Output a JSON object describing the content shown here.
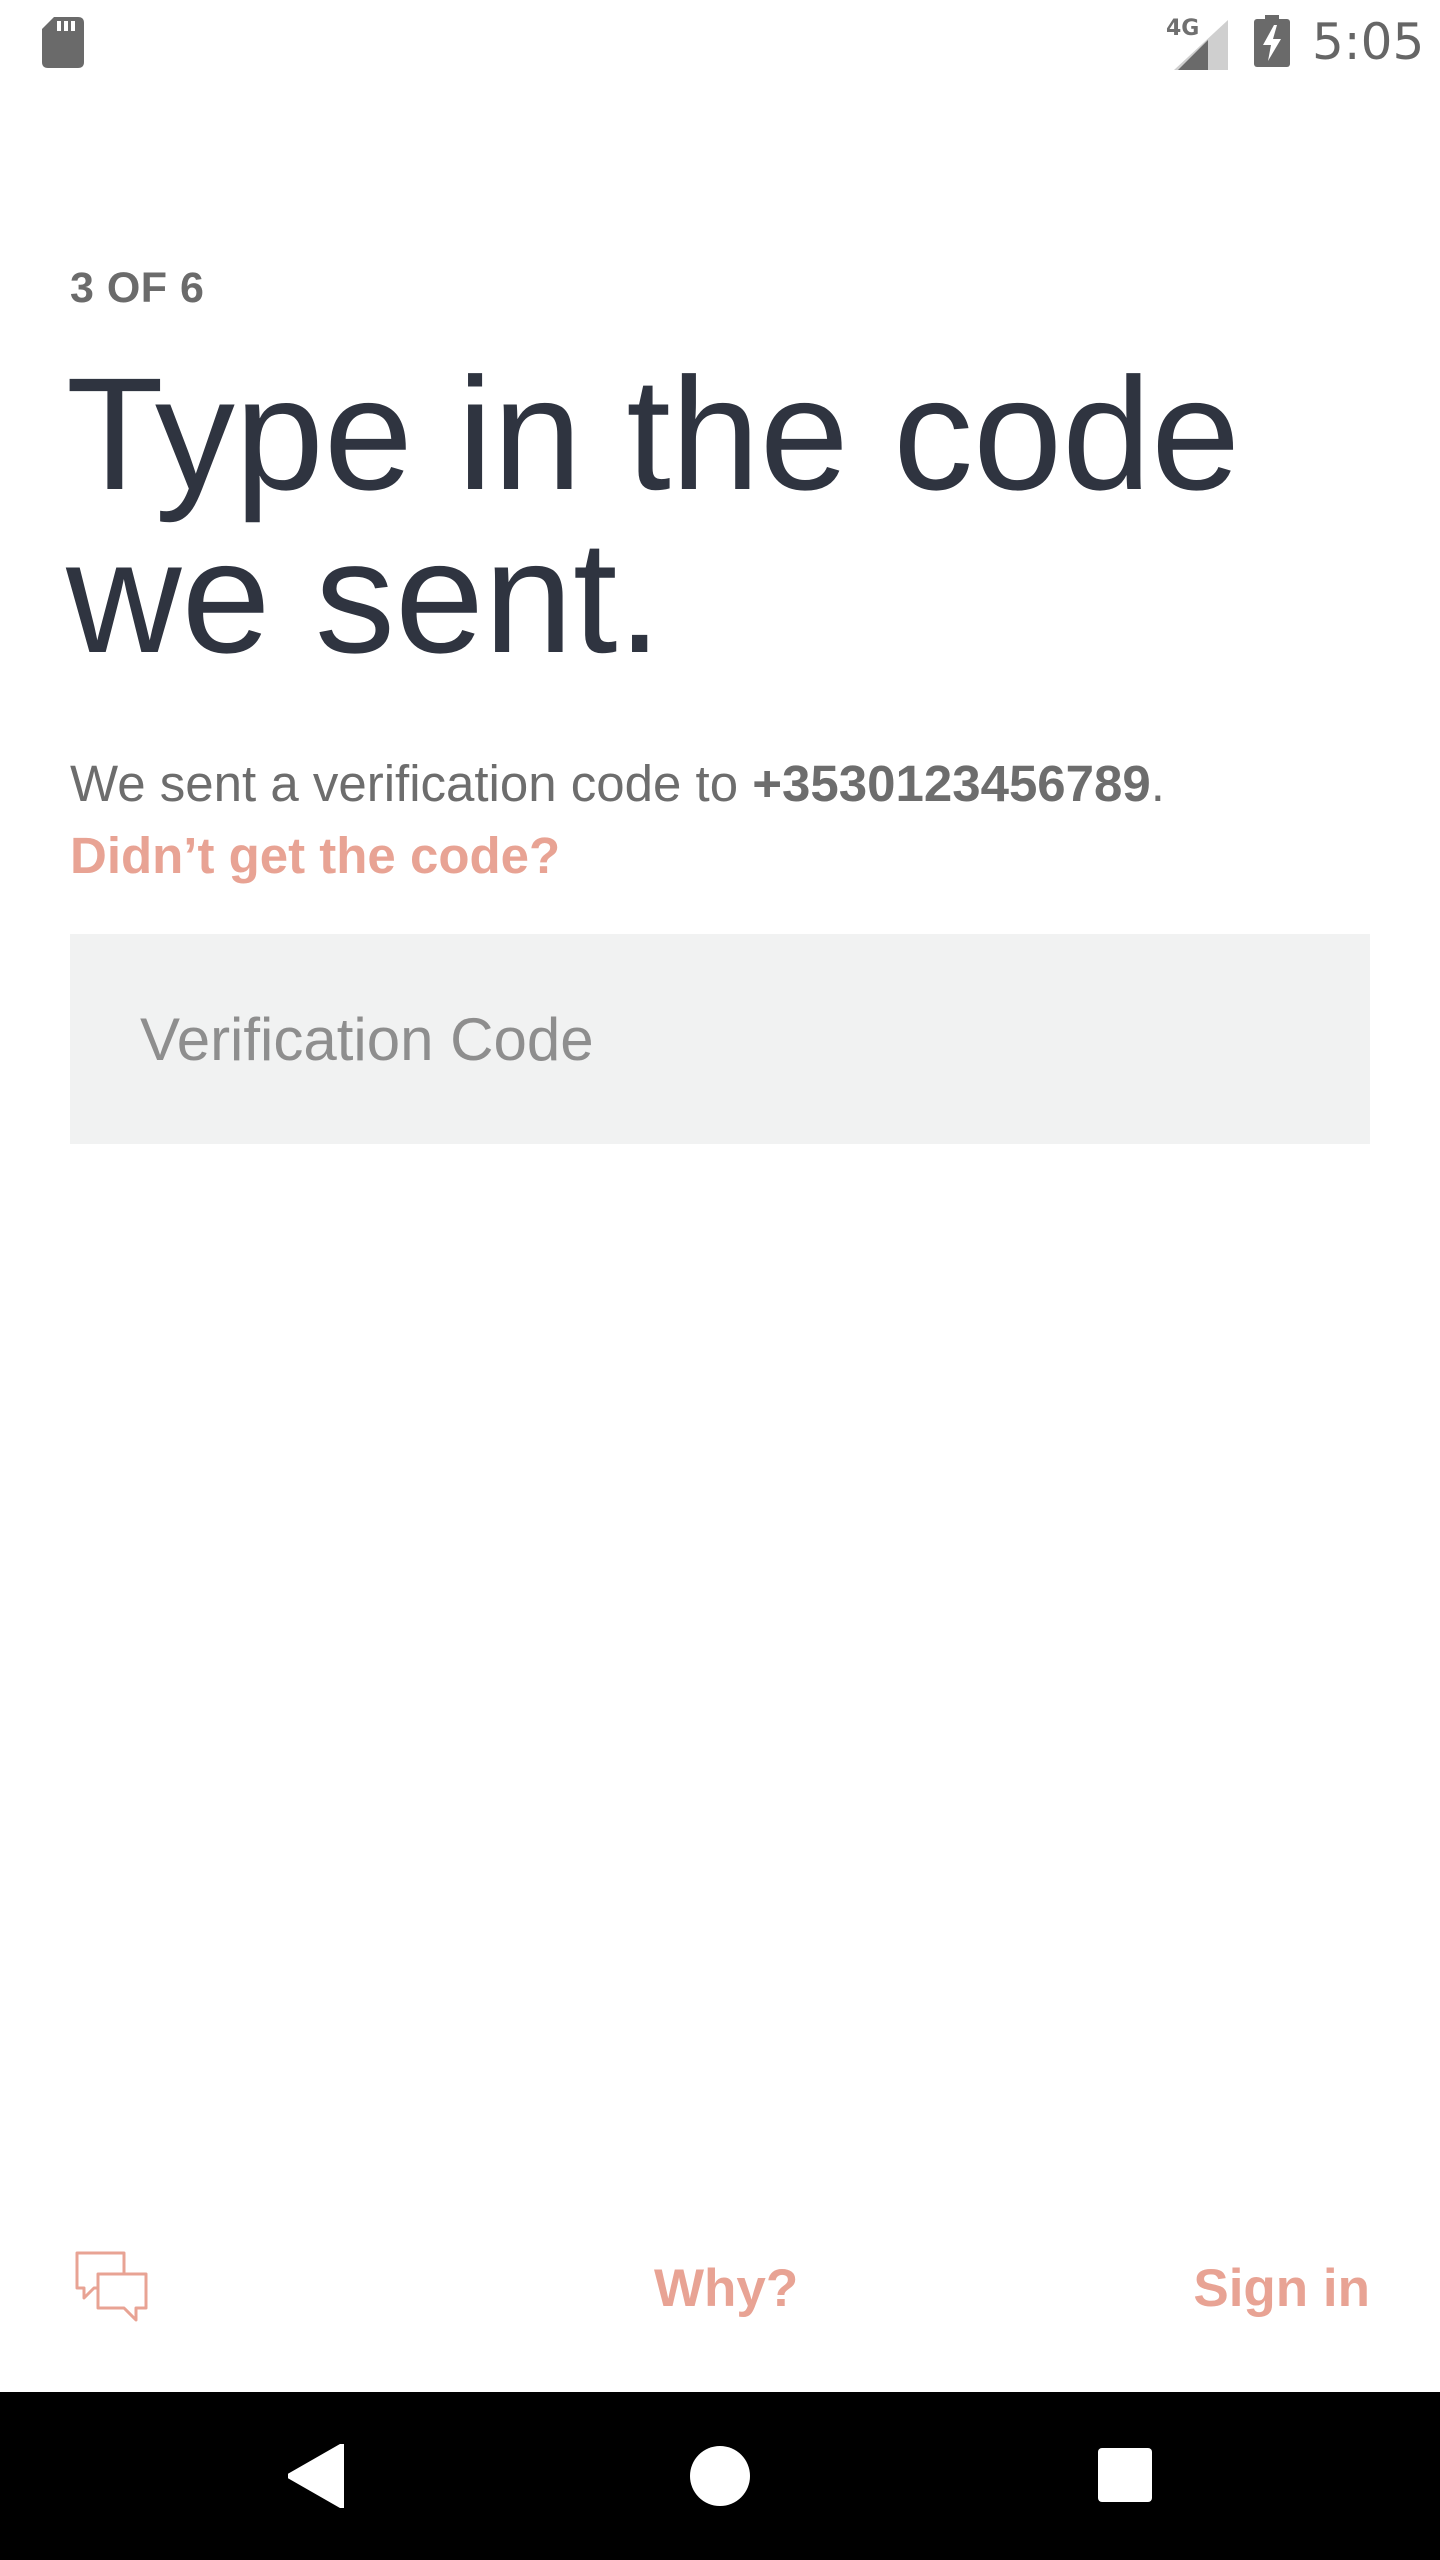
{
  "status_bar": {
    "network": "4G",
    "time": "5:05",
    "icons": [
      "sd-card-icon",
      "signal-icon",
      "battery-charging-icon"
    ]
  },
  "step": "3 OF 6",
  "headline": {
    "line1": "Type in the code",
    "line2": "we sent."
  },
  "description": {
    "prefix": "We sent a verification code to ",
    "phone": "+3530123456789",
    "suffix": "."
  },
  "resend_link": "Didn’t get the code?",
  "code_input": {
    "placeholder": "Verification Code",
    "value": ""
  },
  "footer": {
    "chat_icon": "chat-bubbles-icon",
    "why_label": "Why?",
    "sign_in_label": "Sign in"
  },
  "nav_bar": {
    "icons": [
      "back-icon",
      "home-icon",
      "recents-icon"
    ]
  },
  "colors": {
    "accent": "#e8a394",
    "headline": "#2f3440",
    "body_text": "#6d6d6d",
    "input_bg": "#f1f2f2",
    "nav_bg": "#000000"
  }
}
